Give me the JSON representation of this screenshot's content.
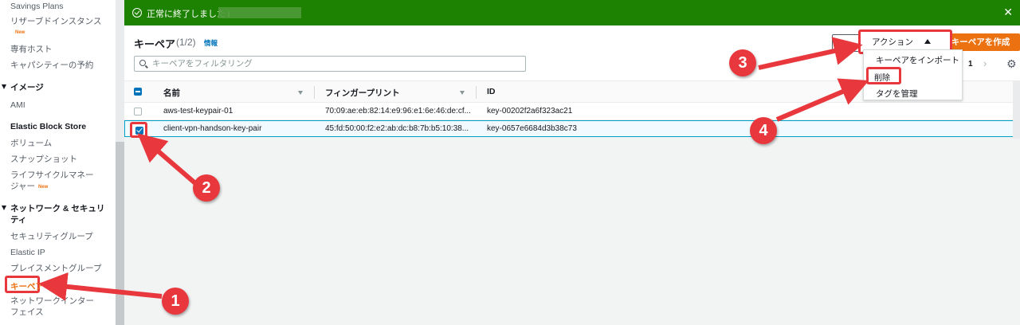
{
  "sidebar": {
    "items": [
      {
        "label": "Savings Plans"
      },
      {
        "label": "リザーブドインスタンス",
        "badge": "New"
      },
      {
        "label": "専有ホスト"
      },
      {
        "label": "キャパシティーの予約"
      },
      {
        "label": "AMI"
      },
      {
        "label": "ボリューム"
      },
      {
        "label": "スナップショット"
      },
      {
        "label": "ライフサイクルマネー"
      },
      {
        "label": "ジャー",
        "badge": "New"
      },
      {
        "label": "セキュリティグループ"
      },
      {
        "label": "Elastic IP"
      },
      {
        "label": "プレイスメントグループ"
      },
      {
        "label": "キーペア"
      },
      {
        "label": "ネットワークインター"
      },
      {
        "label": "フェイス"
      }
    ],
    "sections": [
      {
        "label": "イメージ"
      },
      {
        "label": "Elastic Block Store"
      },
      {
        "label": "ネットワーク & セキュリ"
      },
      {
        "label": "ティ"
      }
    ]
  },
  "flash": {
    "message": "正常に終了しました i",
    "close": "✕"
  },
  "panel": {
    "title": "キーペア",
    "count": "(1/2)",
    "info": "情報",
    "filter_placeholder": "キーペアをフィルタリング",
    "actions_label": "アクション",
    "create_label": "キーペアを作成",
    "page": "1",
    "page_next": "›",
    "settings_icon": "⚙"
  },
  "table": {
    "columns": [
      "名前",
      "フィンガープリント",
      "ID"
    ],
    "rows": [
      {
        "name": "aws-test-keypair-01",
        "fingerprint": "70:09:ae:eb:82:14:e9:96:e1:6e:46:de:cf...",
        "id": "key-00202f2a6f323ac21",
        "selected": false
      },
      {
        "name": "client-vpn-handson-key-pair",
        "fingerprint": "45:fd:50:00:f2:e2:ab:dc:b8:7b:b5:10:38...",
        "id": "key-0657e6684d3b38c73",
        "selected": true
      }
    ]
  },
  "dropdown": {
    "items": [
      "キーペアをインポート",
      "削除",
      "タグを管理"
    ]
  },
  "annotations": {
    "badges": [
      "1",
      "2",
      "3",
      "4"
    ],
    "color": "#e8383d"
  },
  "colors": {
    "flash_bg": "#1d8102",
    "accent": "#ec7211",
    "link": "#0073bb",
    "highlight": "#e8383d"
  }
}
